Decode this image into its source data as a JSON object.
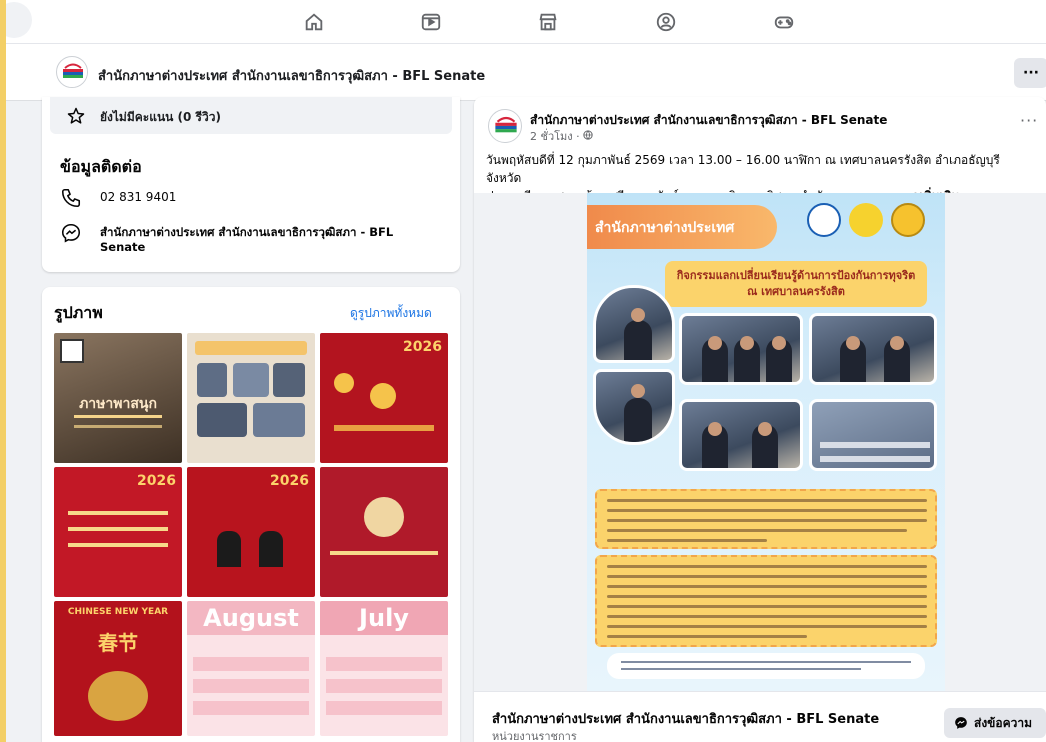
{
  "nav": {
    "icons": [
      "home-icon",
      "video-icon",
      "marketplace-icon",
      "groups-icon",
      "gaming-icon"
    ]
  },
  "page_header": {
    "name": "สำนักภาษาต่างประเทศ สำนักงานเลขาธิการวุฒิสภา - BFL Senate",
    "more": "···"
  },
  "rating": {
    "text": "ยังไม่มีคะแนน (0 รีวิว)"
  },
  "contact": {
    "title": "ข้อมูลติดต่อ",
    "phone": "02 831 9401",
    "messenger_line1": "สำนักภาษาต่างประเทศ สำนักงานเลขาธิการวุฒิสภา - BFL",
    "messenger_line2": "Senate"
  },
  "photos": {
    "title": "รูปภาพ",
    "see_all": "ดูรูปภาพทั้งหมด",
    "tiles": [
      {
        "label": "ภาษาพาสนุก",
        "color": "#5b4a3a"
      },
      {
        "label": "",
        "color": "#d9c9b0"
      },
      {
        "label": "2026",
        "color": "#b3141f"
      },
      {
        "label": "2026",
        "color": "#c21826"
      },
      {
        "label": "2026",
        "color": "#b8141e"
      },
      {
        "label": "",
        "color": "#b01a2a"
      },
      {
        "label": "CHINESE NEW YEAR",
        "sub": "春节",
        "color": "#b3121c"
      },
      {
        "label": "August",
        "color": "#f6c9cf"
      },
      {
        "label": "July",
        "color": "#f3b9c2"
      }
    ]
  },
  "post": {
    "author": "สำนักภาษาต่างประเทศ สำนักงานเลขาธิการวุฒิสภา - BFL Senate",
    "time": "2 ชั่วโมง · ",
    "more": "···",
    "text_line1": "วันพฤหัสบดีที่ 12 กุมภาพันธ์ 2569 เวลา 13.00 – 16.00 นาฬิกา ณ เทศบาลนครรังสิต อำเภอธัญบุรี จังหวัด",
    "text_line2": "ปทุมธานี นางสาวแก้วเกศรี ถาวรพันธ์ รองเลขาธิการวุฒิสภา นำตัวแทนบุคลากร...",
    "see_more": "ดูเพิ่มเติม",
    "poster": {
      "banner": "สำนักภาษาต่างประเทศ",
      "headline_1": "กิจกรรมแลกเปลี่ยนเรียนรู้ด้านการป้องกันการทุจริต",
      "headline_2": "ณ เทศบาลนครรังสิต"
    },
    "footer_name": "สำนักภาษาต่างประเทศ สำนักงานเลขาธิการวุฒิสภา - BFL Senate",
    "footer_type": "หน่วยงานราชการ",
    "message_button": "ส่งข้อความ"
  }
}
